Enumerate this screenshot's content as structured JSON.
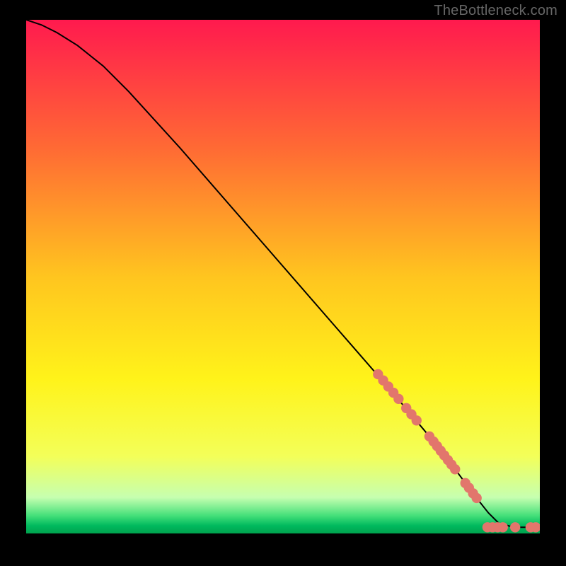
{
  "watermark": "TheBottleneck.com",
  "colors": {
    "background": "#000000",
    "gradient_stops": [
      {
        "offset": 0.0,
        "color": "#ff1a4e"
      },
      {
        "offset": 0.25,
        "color": "#ff6a34"
      },
      {
        "offset": 0.5,
        "color": "#ffc51f"
      },
      {
        "offset": 0.7,
        "color": "#fff31a"
      },
      {
        "offset": 0.85,
        "color": "#f3ff59"
      },
      {
        "offset": 0.93,
        "color": "#c6ffb0"
      },
      {
        "offset": 0.965,
        "color": "#46e07a"
      },
      {
        "offset": 0.985,
        "color": "#00b95e"
      },
      {
        "offset": 1.0,
        "color": "#00a24e"
      }
    ],
    "curve": "#000000",
    "marker_fill": "#e2766c",
    "marker_stroke": "#e2766c"
  },
  "chart_data": {
    "type": "line",
    "title": "",
    "xlabel": "",
    "ylabel": "",
    "xlim": [
      0,
      100
    ],
    "ylim": [
      0,
      100
    ],
    "grid": false,
    "legend": false,
    "series": [
      {
        "name": "curve",
        "x": [
          0,
          3,
          6,
          10,
          15,
          20,
          30,
          40,
          50,
          60,
          70,
          78,
          82,
          85,
          88,
          90,
          92,
          95,
          100
        ],
        "y": [
          100,
          99,
          97.5,
          95,
          91,
          86,
          75,
          63.5,
          52,
          40.5,
          29,
          19.5,
          14.5,
          10.5,
          6.5,
          4,
          2,
          1.2,
          1.2
        ]
      }
    ],
    "markers": [
      {
        "x": 68.5,
        "y": 31.0
      },
      {
        "x": 69.5,
        "y": 29.8
      },
      {
        "x": 70.5,
        "y": 28.6
      },
      {
        "x": 71.5,
        "y": 27.4
      },
      {
        "x": 72.5,
        "y": 26.2
      },
      {
        "x": 74.0,
        "y": 24.4
      },
      {
        "x": 75.0,
        "y": 23.2
      },
      {
        "x": 76.0,
        "y": 22.0
      },
      {
        "x": 78.5,
        "y": 18.9
      },
      {
        "x": 79.3,
        "y": 17.9
      },
      {
        "x": 80.0,
        "y": 17.0
      },
      {
        "x": 80.7,
        "y": 16.1
      },
      {
        "x": 81.4,
        "y": 15.2
      },
      {
        "x": 82.1,
        "y": 14.3
      },
      {
        "x": 82.8,
        "y": 13.4
      },
      {
        "x": 83.5,
        "y": 12.5
      },
      {
        "x": 85.5,
        "y": 9.8
      },
      {
        "x": 86.2,
        "y": 8.9
      },
      {
        "x": 87.0,
        "y": 7.8
      },
      {
        "x": 87.7,
        "y": 6.9
      },
      {
        "x": 89.8,
        "y": 1.2
      },
      {
        "x": 90.8,
        "y": 1.2
      },
      {
        "x": 91.8,
        "y": 1.2
      },
      {
        "x": 92.8,
        "y": 1.2
      },
      {
        "x": 95.2,
        "y": 1.2
      },
      {
        "x": 98.2,
        "y": 1.2
      },
      {
        "x": 99.2,
        "y": 1.2
      }
    ]
  }
}
